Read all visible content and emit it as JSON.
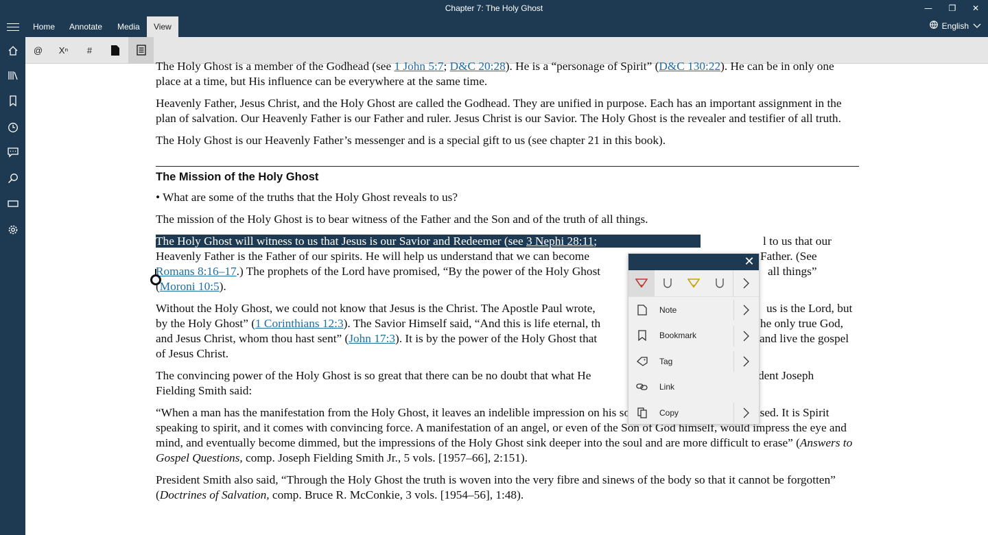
{
  "window": {
    "title": "Chapter 7: The Holy Ghost",
    "controls": [
      "minimize",
      "restore",
      "close"
    ]
  },
  "tabs": [
    {
      "label": "Home"
    },
    {
      "label": "Annotate"
    },
    {
      "label": "Media"
    },
    {
      "label": "View",
      "active": true
    }
  ],
  "language": {
    "label": "English"
  },
  "sidebar": {
    "icons": [
      "home-icon",
      "library-icon",
      "bookmark-icon",
      "history-icon",
      "notes-icon",
      "search-icon",
      "screen-icon",
      "settings-icon"
    ]
  },
  "toolbar": {
    "items": [
      "@",
      "Xⁿ",
      "#"
    ]
  },
  "content": {
    "p1": {
      "a": "The Holy Ghost is a member of the Godhead (see ",
      "link1": "1 John 5:7",
      "b": "; ",
      "link2": "D&C 20:28",
      "c": "). He is a “personage of Spirit” (",
      "link3": "D&C 130:22",
      "d": "). He can be in only one place at a time, but His influence can be everywhere at the same time."
    },
    "p2": "Heavenly Father, Jesus Christ, and the Holy Ghost are called the Godhead. They are unified in purpose. Each has an important assignment in the plan of salvation. Our Heavenly Father is our Father and ruler. Jesus Christ is our Savior. The Holy Ghost is the revealer and testifier of all truth.",
    "p3": "The Holy Ghost is our Heavenly Father’s messenger and is a special gift to us (see chapter 21 in this book).",
    "heading": "The Mission of the Holy Ghost",
    "bullet": "What are some of the truths that the Holy Ghost reveals to us?",
    "p4": "The mission of the Holy Ghost is to bear witness of the Father and the Son and of the truth of all things.",
    "p5": {
      "sel": "The Holy Ghost will witness to us that Jesus is our Savior and Redeemer (see ",
      "link1": "3 Nephi 28:11",
      "sel2": "; ",
      "line1_end": "l to us that our",
      "line2": "Heavenly Father is the Father of our spirits. He will help us understand that we can become",
      "line2_end": "Father. (See",
      "link2": "Romans 8:16–17",
      "line3": ".) The prophets of the Lord have promised, “By the power of the Holy Ghost",
      "line3_end": "all things”",
      "line4a": "(",
      "link3": "Moroni 10:5",
      "line4b": ")."
    },
    "p6": {
      "line1": "Without the Holy Ghost, we could not know that Jesus is the Christ. The Apostle Paul wrote,",
      "line1_end": "us is the Lord, but",
      "line2a": "by the Holy Ghost” (",
      "link1": "1 Corinthians 12:3",
      "line2b": "). The Savior Himself said, “And this is life eternal, th",
      "line2_end": "he only true God,",
      "line3a": "and Jesus Christ, whom thou hast sent” (",
      "link2": "John 17:3",
      "line3b": "). It is by the power of the Holy Ghost that",
      "line3_end": "and live the gospel",
      "line4": "of Jesus Christ."
    },
    "p7": {
      "line1": "The convincing power of the Holy Ghost is so great that there can be no doubt that what He",
      "line1_end": "dent Joseph",
      "line2": "Fielding Smith said:"
    },
    "p8": {
      "text": "“When a man has the manifestation from the Holy Ghost, it leaves an indelible impression on his soul, one that is not easily erased. It is Spirit speaking to spirit, and it comes with convincing force. A manifestation of an angel, or even of the Son of God himself, would impress the eye and mind, and eventually become dimmed, but the impressions of the Holy Ghost sink deeper into the soul and are more difficult to erase” (",
      "italic": "Answers to Gospel Questions,",
      "tail": " comp. Joseph Fielding Smith Jr., 5 vols. [1957–66], 2:151)."
    },
    "p9": {
      "text": "President Smith also said, “Through the Holy Ghost the truth is woven into the very fibre and sinews of the body so that it cannot be forgotten” (",
      "italic": "Doctrines of Salvation,",
      "tail": " comp. Bruce R. McConkie, 3 vols. [1954–56], 1:48)."
    }
  },
  "popup": {
    "highlight_colors": {
      "red": "#c0392b",
      "yellow": "#c9a400"
    },
    "menu": [
      {
        "label": "Note",
        "has_submenu": true
      },
      {
        "label": "Bookmark",
        "has_submenu": true
      },
      {
        "label": "Tag",
        "has_submenu": true
      },
      {
        "label": "Link",
        "has_submenu": false
      },
      {
        "label": "Copy",
        "has_submenu": true
      }
    ]
  }
}
